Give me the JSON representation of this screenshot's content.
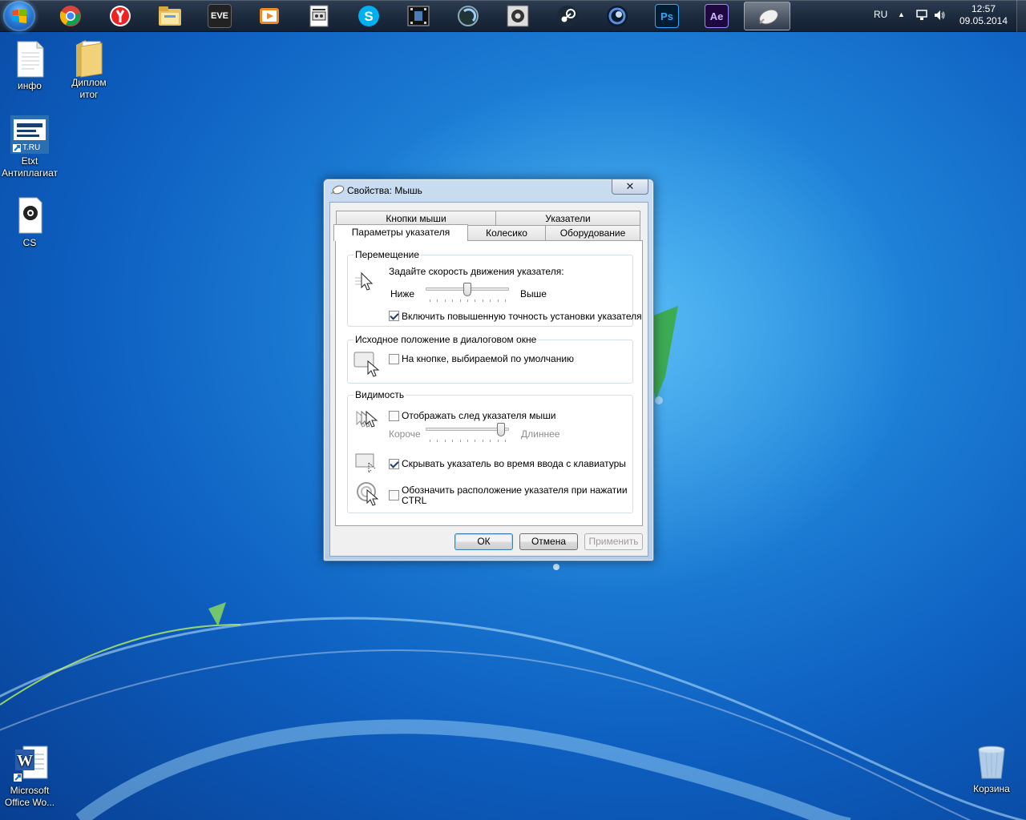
{
  "taskbar": {
    "apps": [
      {
        "name": "chrome-icon"
      },
      {
        "name": "yandex-browser-icon"
      },
      {
        "name": "file-explorer-icon"
      },
      {
        "name": "eve-online-icon",
        "label": "EVE"
      },
      {
        "name": "media-player-icon"
      },
      {
        "name": "document-viewer-icon"
      },
      {
        "name": "skype-icon"
      },
      {
        "name": "video-editor-icon"
      },
      {
        "name": "media-app-icon"
      },
      {
        "name": "settings-app-icon"
      },
      {
        "name": "steam-icon"
      },
      {
        "name": "cinema4d-icon"
      },
      {
        "name": "photoshop-icon",
        "label": "Ps"
      },
      {
        "name": "after-effects-icon",
        "label": "Ae"
      },
      {
        "name": "mouse-properties-icon"
      }
    ],
    "tray": {
      "language": "RU",
      "time": "12:57",
      "date": "09.05.2014"
    }
  },
  "desktop": {
    "icons": {
      "info": "инфо",
      "diploma_line1": "Диплом",
      "diploma_line2": "итог",
      "etxt_badge": "T.RU",
      "etxt_line1": "Etxt",
      "etxt_line2": "Антиплагиат",
      "cs": "CS",
      "word_line1": "Microsoft",
      "word_line2": "Office Wo...",
      "recycle": "Корзина"
    }
  },
  "dialog": {
    "title": "Свойства: Мышь",
    "close": "✕",
    "tabs_row1": [
      "Кнопки мыши",
      "Указатели"
    ],
    "tabs_row2": [
      "Параметры указателя",
      "Колесико",
      "Оборудование"
    ],
    "motion": {
      "group": "Перемещение",
      "prompt": "Задайте скорость движения указателя:",
      "slow": "Ниже",
      "fast": "Выше",
      "speed_fraction": 0.5,
      "precision_label": "Включить повышенную точность установки указателя",
      "precision_checked": true
    },
    "snap": {
      "group": "Исходное положение в диалоговом окне",
      "label": "На кнопке, выбираемой по умолчанию",
      "checked": false
    },
    "visibility": {
      "group": "Видимость",
      "trails_label": "Отображать след указателя мыши",
      "trails_checked": false,
      "short": "Короче",
      "long": "Длиннее",
      "trail_fraction": 0.95,
      "hide_label": "Скрывать указатель во время ввода с клавиатуры",
      "hide_checked": true,
      "ctrl_label_1": "Обозначить расположение указателя при нажатии",
      "ctrl_label_2": "CTRL",
      "ctrl_checked": false
    },
    "buttons": {
      "ok": "ОК",
      "cancel": "Отмена",
      "apply": "Применить"
    }
  }
}
